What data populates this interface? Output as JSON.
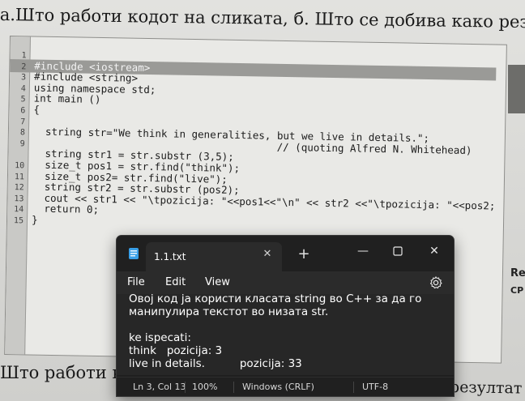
{
  "background": {
    "question_top": "а.Што работи кодот на сликата, б. Што се добива како резултат на",
    "question_bottom": "Што работи ко",
    "question_bottom_right": "резултат на",
    "side_re": "Re",
    "side_cp": "CP",
    "code_lines": [
      {
        "num": "1",
        "text": ""
      },
      {
        "num": "2",
        "text": "#include <iostream>"
      },
      {
        "num": "3",
        "text": "#include <string>"
      },
      {
        "num": "4",
        "text": "using namespace std;"
      },
      {
        "num": "5",
        "text": "int main ()"
      },
      {
        "num": "6",
        "text": "{"
      },
      {
        "num": "7",
        "text": ""
      },
      {
        "num": "8",
        "text": "  string str=\"We think in generalities, but we live in details.\";"
      },
      {
        "num": "9",
        "text": "                                        // (quoting Alfred N. Whitehead)"
      },
      {
        "num": "",
        "text": "  string str1 = str.substr (3,5);"
      },
      {
        "num": "10",
        "text": "  size_t pos1 = str.find(\"think\");"
      },
      {
        "num": "11",
        "text": "  size_t pos2= str.find(\"live\");"
      },
      {
        "num": "12",
        "text": "  string str2 = str.substr (pos2);"
      },
      {
        "num": "13",
        "text": "  cout << str1 << \"\\tpozicija: \"<<pos1<<\"\\n\" << str2 <<\"\\tpozicija: \"<<pos2;"
      },
      {
        "num": "14",
        "text": "  return 0;"
      },
      {
        "num": "15",
        "text": "}"
      }
    ]
  },
  "notepad": {
    "tab_title": "1.1.txt",
    "close_tab_icon": "close-icon",
    "new_tab_symbol": "+",
    "menu": {
      "file": "File",
      "edit": "Edit",
      "view": "View"
    },
    "content": [
      "Овој код ја користи класата string во C++ за да го",
      "манипулира текстот во низата str.",
      "",
      "ke ispecati:",
      "think   pozicija: 3",
      "live in details.          pozicija: 33"
    ],
    "status": {
      "position": "Ln 3, Col 13",
      "zoom": "100%",
      "line_ending": "Windows (CRLF)",
      "encoding": "UTF-8"
    }
  }
}
